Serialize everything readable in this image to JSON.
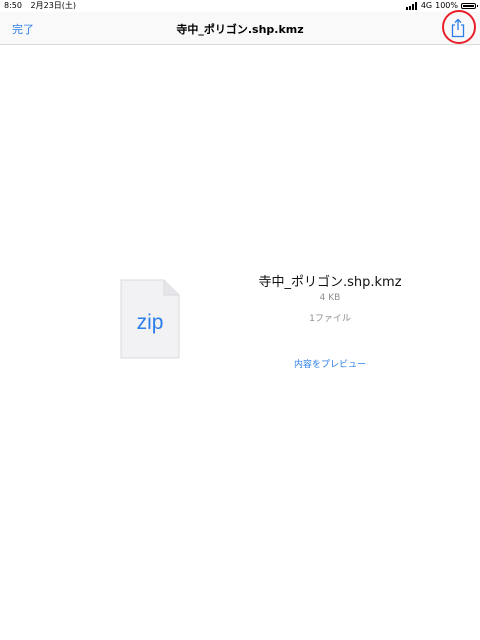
{
  "status_bar": {
    "time": "8:50",
    "date": "2月23日(土)",
    "network": "4G",
    "battery": "100%"
  },
  "nav": {
    "done_label": "完了",
    "title": "寺中_ポリゴン.shp.kmz",
    "share_icon": "share-icon"
  },
  "file": {
    "icon_label": "zip",
    "name": "寺中_ポリゴン.shp.kmz",
    "size": "4 KB",
    "count": "1ファイル",
    "preview_label": "内容をプレビュー"
  },
  "colors": {
    "accent": "#2b7de9",
    "highlight": "#e8202a",
    "secondary_text": "#8e8e93"
  }
}
